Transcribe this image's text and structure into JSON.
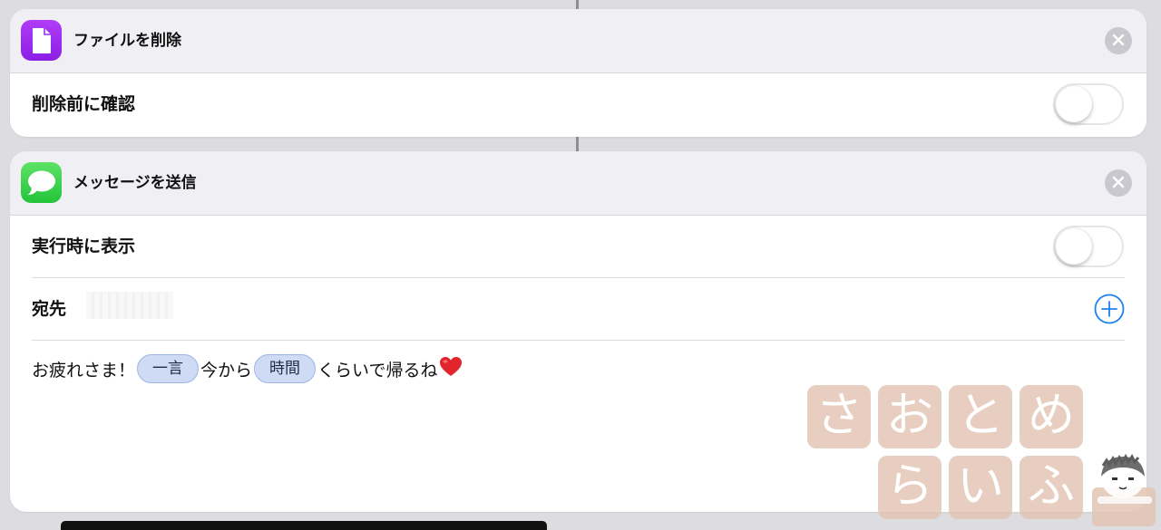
{
  "card1": {
    "title": "ファイルを削除",
    "icon": "file-document-icon",
    "toggle_label": "削除前に確認",
    "toggle_on": false
  },
  "card2": {
    "title": "メッセージを送信",
    "icon": "messages-bubble-icon",
    "toggle_label": "実行時に表示",
    "toggle_on": false,
    "recipient_label": "宛先",
    "message": {
      "part1": "お疲れさま！",
      "token1": "一言",
      "part2": "今から",
      "token2": "時間",
      "part3": "くらいで帰るね",
      "emoji": "❤️"
    }
  },
  "watermark": {
    "chars": [
      "さ",
      "お",
      "と",
      "め",
      "ら",
      "い",
      "ふ"
    ]
  },
  "colors": {
    "files_accent": "#9b2ff0",
    "messages_accent": "#34c759",
    "plus_blue": "#1a82f0",
    "token_bg": "#cfdbf5"
  }
}
